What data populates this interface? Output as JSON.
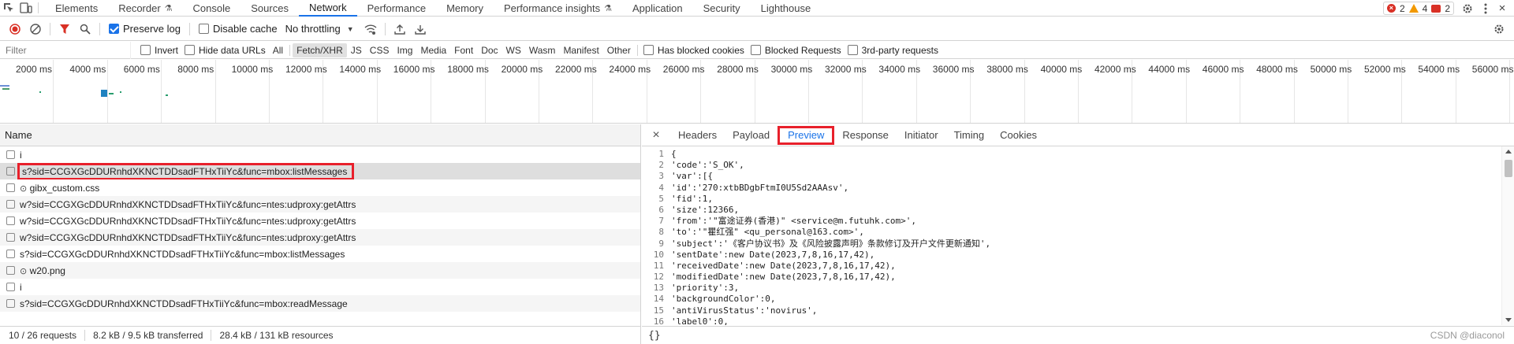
{
  "tabs": [
    {
      "label": "Elements",
      "active": false
    },
    {
      "label": "Recorder",
      "active": false,
      "flask": true
    },
    {
      "label": "Console",
      "active": false
    },
    {
      "label": "Sources",
      "active": false
    },
    {
      "label": "Network",
      "active": true
    },
    {
      "label": "Performance",
      "active": false
    },
    {
      "label": "Memory",
      "active": false
    },
    {
      "label": "Performance insights",
      "active": false,
      "flask": true
    },
    {
      "label": "Application",
      "active": false
    },
    {
      "label": "Security",
      "active": false
    },
    {
      "label": "Lighthouse",
      "active": false
    }
  ],
  "status": {
    "errors": "2",
    "warnings": "4",
    "messages": "2"
  },
  "toolbar": {
    "preserve_log": "Preserve log",
    "disable_cache": "Disable cache",
    "throttling": "No throttling"
  },
  "filter": {
    "placeholder": "Filter",
    "invert": "Invert",
    "hide_data_urls": "Hide data URLs",
    "types": [
      "All",
      "Fetch/XHR",
      "JS",
      "CSS",
      "Img",
      "Media",
      "Font",
      "Doc",
      "WS",
      "Wasm",
      "Manifest",
      "Other"
    ],
    "active_type": "Fetch/XHR",
    "has_blocked_cookies": "Has blocked cookies",
    "blocked_requests": "Blocked Requests",
    "third_party": "3rd-party requests"
  },
  "overview": {
    "ticks": [
      "2000 ms",
      "4000 ms",
      "6000 ms",
      "8000 ms",
      "10000 ms",
      "12000 ms",
      "14000 ms",
      "16000 ms",
      "18000 ms",
      "20000 ms",
      "22000 ms",
      "24000 ms",
      "26000 ms",
      "28000 ms",
      "30000 ms",
      "32000 ms",
      "34000 ms",
      "36000 ms",
      "38000 ms",
      "40000 ms",
      "42000 ms",
      "44000 ms",
      "46000 ms",
      "48000 ms",
      "50000 ms",
      "52000 ms",
      "54000 ms",
      "56000 ms"
    ]
  },
  "list": {
    "header": "Name",
    "rows": [
      {
        "name": "i",
        "symbol": ""
      },
      {
        "name": "s?sid=CCGXGcDDURnhdXKNCTDDsadFTHxTiiYc&func=mbox:listMessages",
        "symbol": "",
        "selected": true
      },
      {
        "name": "gibx_custom.css",
        "symbol": "⊙"
      },
      {
        "name": "w?sid=CCGXGcDDURnhdXKNCTDDsadFTHxTiiYc&func=ntes:udproxy:getAttrs",
        "symbol": ""
      },
      {
        "name": "w?sid=CCGXGcDDURnhdXKNCTDDsadFTHxTiiYc&func=ntes:udproxy:getAttrs",
        "symbol": ""
      },
      {
        "name": "w?sid=CCGXGcDDURnhdXKNCTDDsadFTHxTiiYc&func=ntes:udproxy:getAttrs",
        "symbol": ""
      },
      {
        "name": "s?sid=CCGXGcDDURnhdXKNCTDDsadFTHxTiiYc&func=mbox:listMessages",
        "symbol": ""
      },
      {
        "name": "w20.png",
        "symbol": "⊙"
      },
      {
        "name": "i",
        "symbol": ""
      },
      {
        "name": "s?sid=CCGXGcDDURnhdXKNCTDDsadFTHxTiiYc&func=mbox:readMessage",
        "symbol": ""
      }
    ]
  },
  "detail": {
    "tabs": [
      "Headers",
      "Payload",
      "Preview",
      "Response",
      "Initiator",
      "Timing",
      "Cookies"
    ],
    "active_tab": "Preview",
    "lines": [
      "{",
      "'code':'S_OK',",
      "'var':[{",
      "'id':'270:xtbBDgbFtmI0U5Sd2AAAsv',",
      "'fid':1,",
      "'size':12366,",
      "'from':'\"富途证券(香港)\" <service@m.futuhk.com>',",
      "'to':'\"瞿红强\" <qu_personal@163.com>',",
      "'subject':'《客户协议书》及《风险披露声明》条款修订及开户文件更新通知',",
      "'sentDate':new Date(2023,7,8,16,17,42),",
      "'receivedDate':new Date(2023,7,8,16,17,42),",
      "'modifiedDate':new Date(2023,7,8,16,17,42),",
      "'priority':3,",
      "'backgroundColor':0,",
      "'antiVirusStatus':'novirus',",
      "'label0':0,"
    ]
  },
  "statusbar": {
    "requests": "10 / 26 requests",
    "transferred": "8.2 kB / 9.5 kB transferred",
    "resources": "28.4 kB / 131 kB resources"
  },
  "watermark": "CSDN @diaconol",
  "colors": {
    "accent": "#1a73e8",
    "highlight": "#e8202b"
  }
}
